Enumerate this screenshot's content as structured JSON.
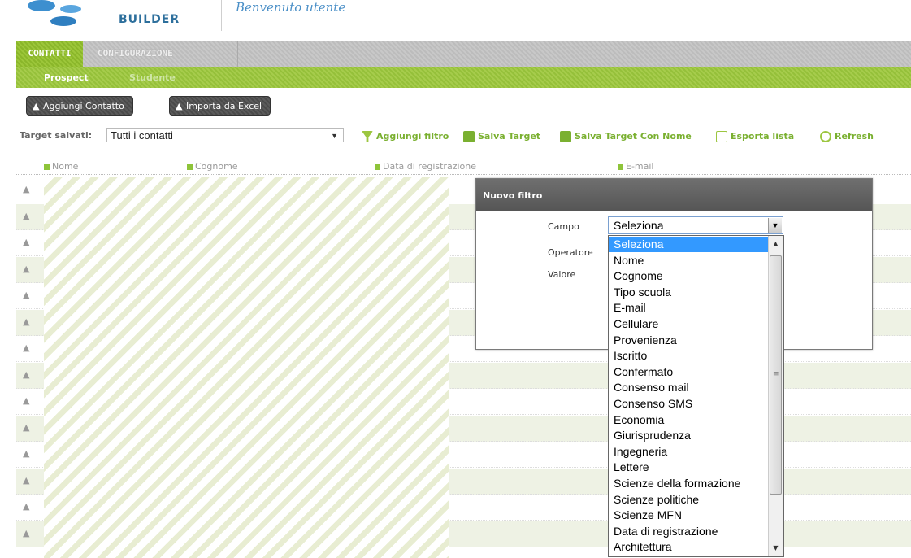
{
  "header": {
    "logo_text": "BUILDER",
    "welcome": "Benvenuto utente"
  },
  "tabs": [
    {
      "label": "CONTATTI",
      "active": true
    },
    {
      "label": "CONFIGURAZIONE",
      "active": false
    }
  ],
  "subtabs": [
    {
      "label": "Prospect",
      "active": true
    },
    {
      "label": "Studente",
      "active": false
    }
  ],
  "actions": {
    "add_contact": "Aggiungi Contatto",
    "import_excel": "Importa da Excel"
  },
  "filterbar": {
    "target_label": "Target salvati:",
    "target_value": "Tutti i contatti",
    "tools": [
      {
        "label": "Aggiungi filtro",
        "icon": "funnel-icon"
      },
      {
        "label": "Salva Target",
        "icon": "save-icon"
      },
      {
        "label": "Salva Target Con Nome",
        "icon": "save-as-icon"
      },
      {
        "label": "Esporta lista",
        "icon": "export-icon"
      },
      {
        "label": "Refresh",
        "icon": "refresh-icon"
      }
    ]
  },
  "grid": {
    "columns": [
      "Nome",
      "Cognome",
      "Data di registrazione",
      "E-mail"
    ],
    "row_count": 14
  },
  "modal": {
    "title": "Nuovo filtro",
    "campo_label": "Campo",
    "operatore_label": "Operatore",
    "valore_label": "Valore",
    "campo_value": "Seleziona"
  },
  "dropdown": {
    "options": [
      "Seleziona",
      "Nome",
      "Cognome",
      "Tipo scuola",
      "E-mail",
      "Cellulare",
      "Provenienza",
      "Iscritto",
      "Confermato",
      "Consenso mail",
      "Consenso SMS",
      "Economia",
      "Giurisprudenza",
      "Ingegneria",
      "Lettere",
      "Scienze della formazione",
      "Scienze politiche",
      "Scienze MFN",
      "Data di registrazione",
      "Architettura"
    ],
    "selected": "Seleziona"
  },
  "colors": {
    "accent_green": "#8ab62a",
    "selection_blue": "#3399ff"
  }
}
